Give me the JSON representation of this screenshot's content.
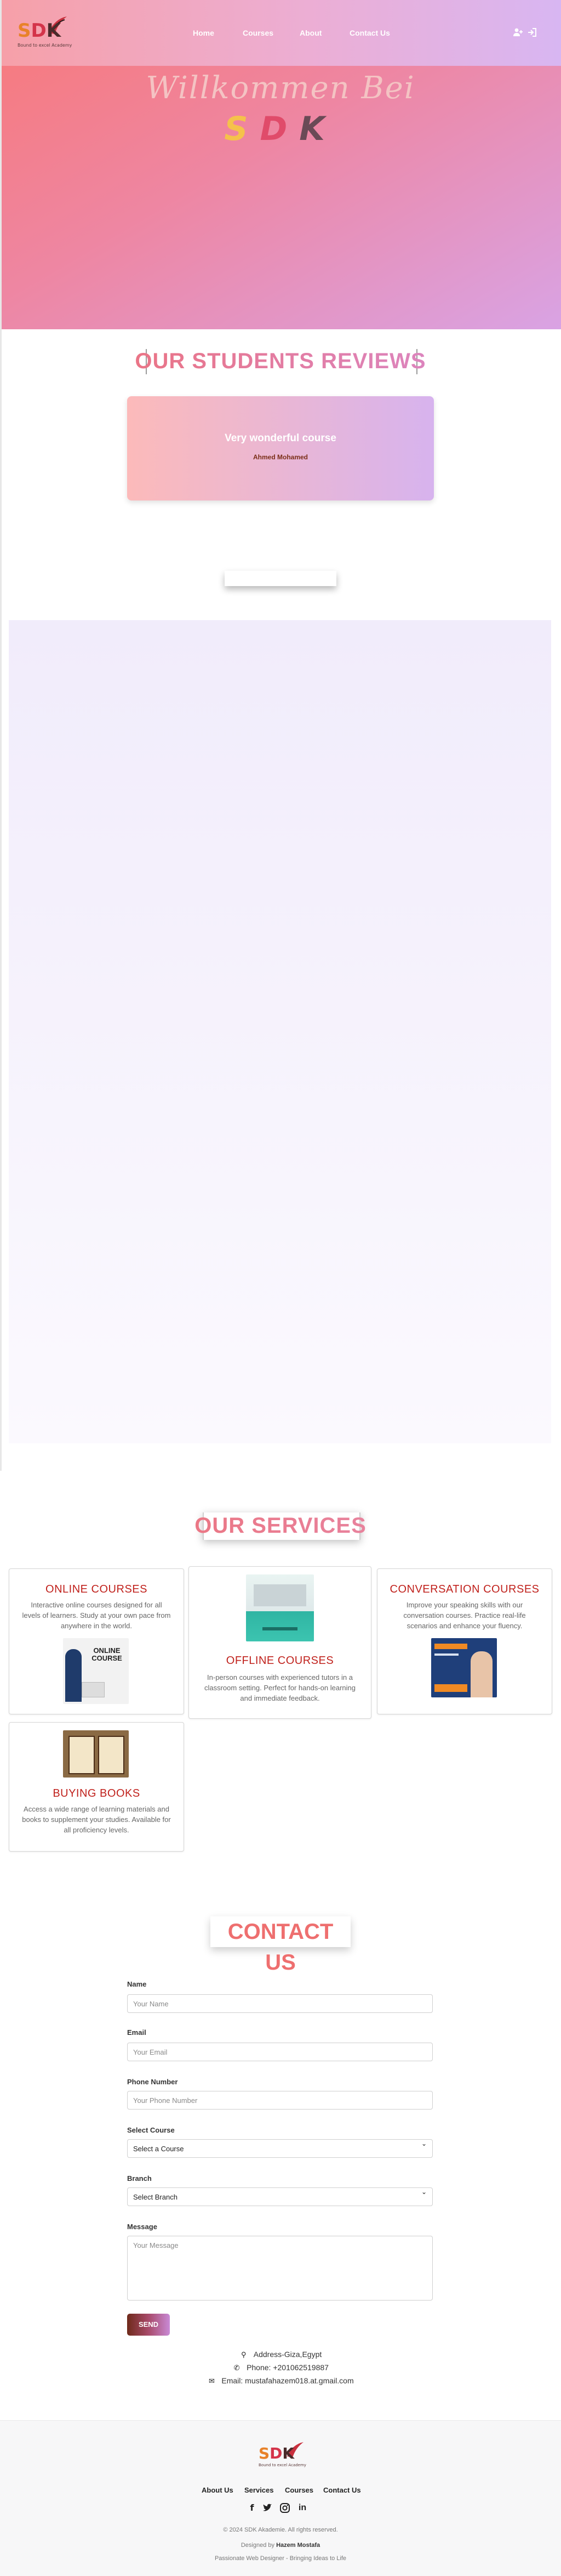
{
  "brand": {
    "logo_letters": [
      "S",
      "D",
      "K"
    ],
    "logo_subtitle": "Bound to excel Academy",
    "colors": {
      "s": "#e8822a",
      "d": "#d4344a",
      "k": "#4a2a2a"
    }
  },
  "nav": {
    "links": [
      "Home",
      "Courses",
      "About",
      "Contact Us"
    ],
    "icons": [
      "user-plus-icon",
      "sign-in-icon"
    ]
  },
  "hero": {
    "title": "Willkommen Bei",
    "sdk_letters": [
      "S",
      "D",
      "K"
    ]
  },
  "reviews": {
    "heading": "OUR STUDENTS REVIEWS",
    "items": [
      {
        "text": "Very wonderful course",
        "author": "Ahmed Mohamed"
      }
    ]
  },
  "services": {
    "heading": "OUR SERVICES",
    "items": [
      {
        "title": "ONLINE COURSES",
        "description": "Interactive online courses designed for all levels of learners. Study at your own pace from anywhere in the world.",
        "image_caption": "ONLINE COURSE"
      },
      {
        "title": "OFFLINE COURSES",
        "description": "In-person courses with experienced tutors in a classroom setting. Perfect for hands-on learning and immediate feedback.",
        "image_caption": ""
      },
      {
        "title": "CONVERSATION COURSES",
        "description": "Improve your speaking skills with our conversation courses. Practice real-life scenarios and enhance your fluency.",
        "image_caption": ""
      },
      {
        "title": "BUYING BOOKS",
        "description": "Access a wide range of learning materials and books to supplement your studies. Available for all proficiency levels.",
        "image_caption": ""
      }
    ]
  },
  "contact": {
    "heading": "CONTACT US",
    "fields": {
      "name": {
        "label": "Name",
        "placeholder": "Your Name"
      },
      "email": {
        "label": "Email",
        "placeholder": "Your Email"
      },
      "phone": {
        "label": "Phone Number",
        "placeholder": "Your Phone Number"
      },
      "course": {
        "label": "Select Course",
        "value": "Select a Course"
      },
      "branch": {
        "label": "Branch",
        "value": "Select Branch"
      },
      "message": {
        "label": "Message",
        "placeholder": "Your Message"
      }
    },
    "send_label": "SEND",
    "info": {
      "address": "Address-Giza,Egypt",
      "phone": "Phone: +201062519887",
      "email": "Email: mustafahazem018.at.gmail.com"
    }
  },
  "footer": {
    "links": [
      "About Us",
      "Services",
      "Courses",
      "Contact Us"
    ],
    "social_icons": [
      "facebook-icon",
      "twitter-icon",
      "instagram-icon",
      "linkedin-icon"
    ],
    "copyright": "© 2024 SDK Akademie. All rights reserved.",
    "designed_prefix": "Designed by",
    "designer": "Hazem Mostafa",
    "tagline": "Passionate Web Designer - Bringing Ideas to Life"
  }
}
